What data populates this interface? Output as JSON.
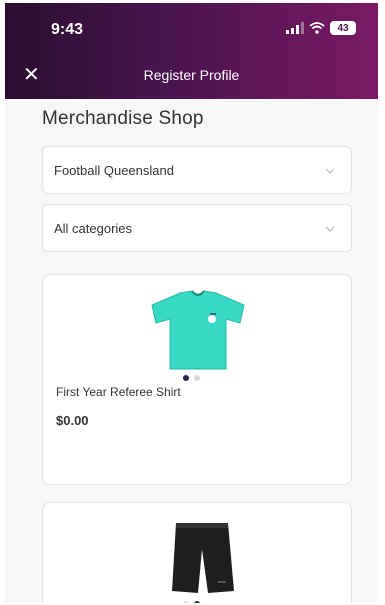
{
  "status_bar": {
    "time": "9:43",
    "battery": "43"
  },
  "header": {
    "title": "Register Profile"
  },
  "page": {
    "title": "Merchandise Shop"
  },
  "filters": {
    "organisation": "Football Queensland",
    "category": "All categories"
  },
  "products": [
    {
      "name": "First Year Referee Shirt",
      "price": "$0.00",
      "image": "referee-shirt-image",
      "color": "#35d9c4"
    },
    {
      "name": "",
      "price": "",
      "image": "referee-shorts-image",
      "color": "#1e1e1e"
    }
  ],
  "colors": {
    "header_start": "#2a0e30",
    "header_end": "#7a1a63",
    "background": "#f7f7f7"
  }
}
